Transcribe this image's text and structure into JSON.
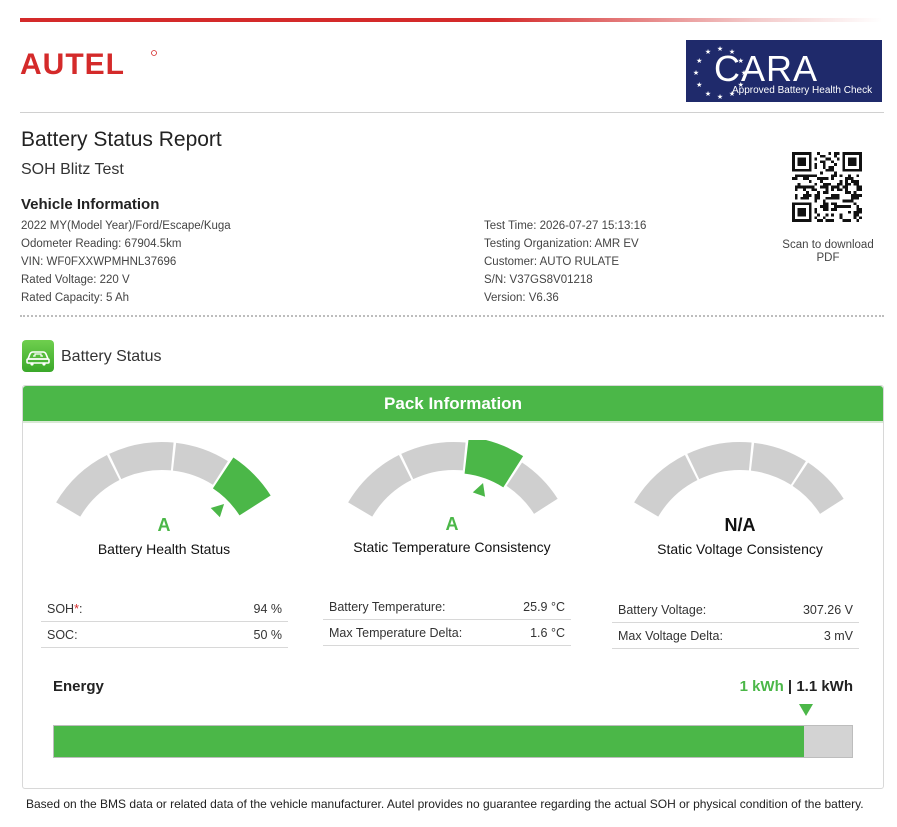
{
  "brand": {
    "logo_text": "AUTEL",
    "badge_title": "CARA",
    "badge_subtitle": "Approved Battery Health Check",
    "brand_color": "#d42a2a",
    "badge_color": "#1f2a6b"
  },
  "report": {
    "title": "Battery Status Report",
    "subtitle": "SOH Blitz Test",
    "vehicle_heading": "Vehicle Information"
  },
  "vehicle": {
    "model": "2022 MY(Model Year)/Ford/Escape/Kuga",
    "odometer": "Odometer Reading: 67904.5km",
    "vin": "VIN: WF0FXXWPMHNL37696",
    "rated_voltage": "Rated Voltage: 220 V",
    "rated_capacity": "Rated Capacity: 5 Ah"
  },
  "test": {
    "time": "Test Time: 2026-07-27 15:13:16",
    "organization": "Testing Organization: AMR EV",
    "customer": "Customer: AUTO RULATE",
    "sn": "S/N: V37GS8V01218",
    "version": "Version: V6.36"
  },
  "qr": {
    "caption": "Scan to download PDF",
    "icon": "qr-code-icon"
  },
  "battery_status": {
    "label": "Battery Status",
    "icon": "battery-car-icon",
    "panel_title": "Pack Information",
    "accent": "#4bb748"
  },
  "gauges": [
    {
      "grade": "A",
      "label": "Battery Health Status",
      "color": "#4bb748",
      "active_segment": 3
    },
    {
      "grade": "A",
      "label": "Static Temperature Consistency",
      "color": "#4bb748",
      "active_segment": 2
    },
    {
      "grade": "N/A",
      "label": "Static Voltage Consistency",
      "color": "#111111",
      "active_segment": -1
    }
  ],
  "health_rows": [
    {
      "key": "SOH",
      "required_mark": "*",
      "suffix": ":",
      "value": "94 %"
    },
    {
      "key": "SOC:",
      "required_mark": "",
      "suffix": "",
      "value": "50 %"
    }
  ],
  "temp_rows": [
    {
      "key": "Battery Temperature:",
      "value": "25.9 °C"
    },
    {
      "key": "Max Temperature Delta:",
      "value": "1.6 °C"
    }
  ],
  "voltage_rows": [
    {
      "key": "Battery Voltage:",
      "value": "307.26 V"
    },
    {
      "key": "Max Voltage Delta:",
      "value": "3 mV"
    }
  ],
  "energy": {
    "label": "Energy",
    "current": "1 kWh",
    "separator": " | ",
    "total": "1.1 kWh",
    "fraction": 0.94
  },
  "disclaimer": "Based on the BMS data or related data of the vehicle manufacturer. Autel provides no guarantee regarding the actual SOH or physical condition of the battery."
}
